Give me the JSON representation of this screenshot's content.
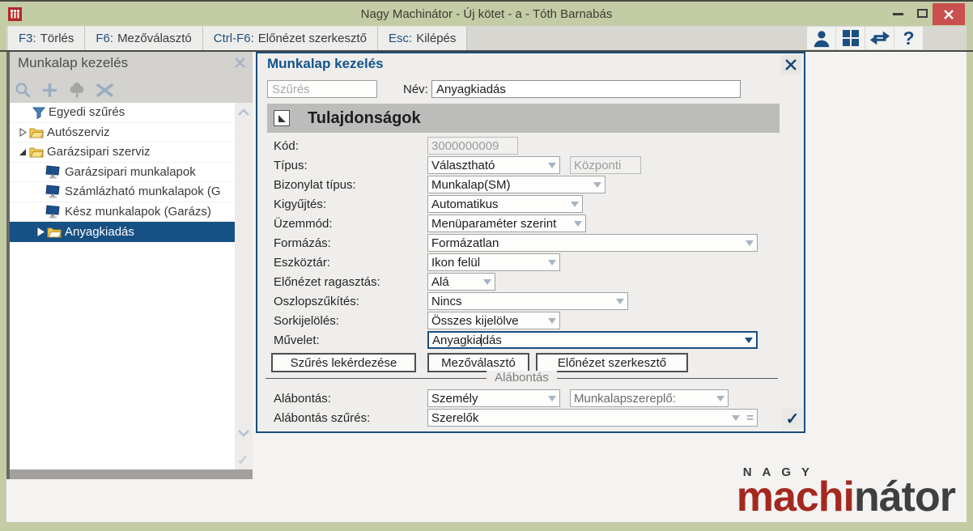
{
  "window": {
    "title": "Nagy Machinátor - Új kötet - a - Tóth Barnabás"
  },
  "toolbar": {
    "tabs": [
      {
        "key": "F3:",
        "label": "Törlés"
      },
      {
        "key": "F6:",
        "label": "Mezőválasztó"
      },
      {
        "key": "Ctrl-F6:",
        "label": "Előnézet szerkesztő"
      },
      {
        "key": "Esc:",
        "label": "Kilépés"
      }
    ],
    "help_glyph": "?"
  },
  "sidebar": {
    "title": "Munkalap kezelés",
    "tree": [
      {
        "label": "Egyedi szűrés",
        "icon": "filter-icon",
        "level": 0,
        "selected": false
      },
      {
        "label": "Autószerviz",
        "icon": "folder-icon",
        "expander": "collapsed",
        "level": 0,
        "selected": false
      },
      {
        "label": "Garázsipari szerviz",
        "icon": "folder-icon",
        "expander": "expanded",
        "level": 0,
        "selected": false
      },
      {
        "label": "Garázsipari munkalapok",
        "icon": "monitor-icon",
        "level": 1,
        "selected": false
      },
      {
        "label": "Számlázható munkalapok (G",
        "icon": "monitor-icon",
        "level": 1,
        "selected": false
      },
      {
        "label": "Kész munkalapok (Garázs)",
        "icon": "monitor-icon",
        "level": 1,
        "selected": false
      },
      {
        "label": "Anyagkiadás",
        "icon": "folder-icon",
        "expander": "collapsed",
        "level": 1,
        "selected": true
      }
    ]
  },
  "panel": {
    "title": "Munkalap kezelés",
    "filter_placeholder": "Szűrés",
    "name_label": "Név:",
    "name_value": "Anyagkiadás",
    "section_title": "Tulajdonságok",
    "fields": {
      "kod": {
        "label": "Kód:",
        "value": "3000000009"
      },
      "tipus": {
        "label": "Típus:",
        "value": "Választható",
        "extra": "Központi"
      },
      "bizonylat": {
        "label": "Bizonylat típus:",
        "value": "Munkalap(SM)"
      },
      "kigyujtes": {
        "label": "Kigyűjtés:",
        "value": "Automatikus"
      },
      "uzemmod": {
        "label": "Üzemmód:",
        "value": "Menüparaméter szerint"
      },
      "formazas": {
        "label": "Formázás:",
        "value": "Formázatlan"
      },
      "eszkoztar": {
        "label": "Eszköztár:",
        "value": "Ikon felül"
      },
      "elonezet": {
        "label": "Előnézet ragasztás:",
        "value": "Alá"
      },
      "oszlop": {
        "label": "Oszlopszűkítés:",
        "value": "Nincs"
      },
      "sorkijeloles": {
        "label": "Sorkijelölés:",
        "value": "Összes kijelölve"
      },
      "muvelet": {
        "label": "Művelet:",
        "value": "Anyagkiadás"
      }
    },
    "buttons": [
      "Szűrés lekérdezése",
      "Mezőválasztó",
      "Előnézet szerkesztő"
    ],
    "subsection_title": "Alábontás",
    "alabontas": {
      "label": "Alábontás:",
      "value": "Személy",
      "extra": "Munkalapszereplő:"
    },
    "alabontas_szures": {
      "label": "Alábontás szűrés:",
      "value": "Szerelők",
      "eq_glyph": "="
    },
    "confirm_glyph": "✓"
  },
  "logo": {
    "top": "NAGY",
    "accent": "machi",
    "rest": "nátor"
  },
  "colors": {
    "titlebar_green": "#c3cca5",
    "accent_navy": "#1b4e7e",
    "selected_row": "#175085",
    "close_red": "#c9504e",
    "logo_red": "#a3291f"
  }
}
